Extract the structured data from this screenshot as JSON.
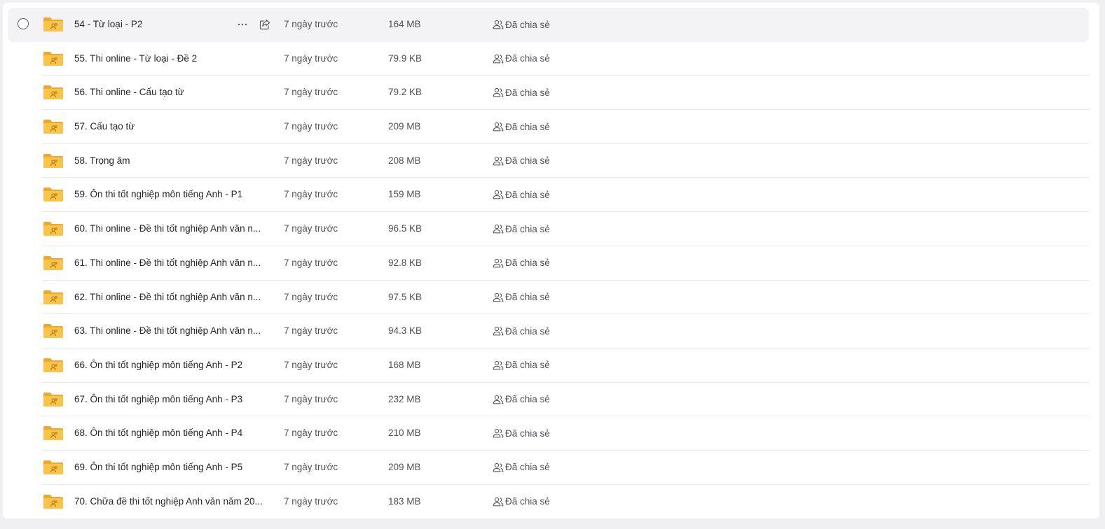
{
  "colors": {
    "folder_body": "#f8c44b",
    "folder_tab": "#eda92d",
    "folder_glyph": "#b57b12",
    "icon_gray": "#5a5a62"
  },
  "icons": {
    "folder": "shared-folder-icon",
    "more": "more-horizontal-icon",
    "share": "share-icon",
    "shared": "users-icon",
    "select": "radio-circle"
  },
  "files": [
    {
      "name": "54 - Từ loại - P2",
      "modified": "7 ngày trước",
      "size": "164 MB",
      "sharing": "Đã chia sẻ"
    },
    {
      "name": "55. Thi online - Từ loại - Đề 2",
      "modified": "7 ngày trước",
      "size": "79.9 KB",
      "sharing": "Đã chia sẻ"
    },
    {
      "name": "56. Thi online - Cấu tạo từ",
      "modified": "7 ngày trước",
      "size": "79.2 KB",
      "sharing": "Đã chia sẻ"
    },
    {
      "name": "57. Cấu tạo từ",
      "modified": "7 ngày trước",
      "size": "209 MB",
      "sharing": "Đã chia sẻ"
    },
    {
      "name": "58. Trọng âm",
      "modified": "7 ngày trước",
      "size": "208 MB",
      "sharing": "Đã chia sẻ"
    },
    {
      "name": "59. Ôn thi tốt nghiệp môn tiếng Anh - P1",
      "modified": "7 ngày trước",
      "size": "159 MB",
      "sharing": "Đã chia sẻ"
    },
    {
      "name": "60. Thi online - Đề thi tốt nghiệp Anh văn n...",
      "modified": "7 ngày trước",
      "size": "96.5 KB",
      "sharing": "Đã chia sẻ"
    },
    {
      "name": "61. Thi online - Đề thi tốt nghiệp Anh văn n...",
      "modified": "7 ngày trước",
      "size": "92.8 KB",
      "sharing": "Đã chia sẻ"
    },
    {
      "name": "62. Thi online - Đề thi tốt nghiệp Anh văn n...",
      "modified": "7 ngày trước",
      "size": "97.5 KB",
      "sharing": "Đã chia sẻ"
    },
    {
      "name": "63. Thi online - Đề thi tốt nghiệp Anh văn n...",
      "modified": "7 ngày trước",
      "size": "94.3 KB",
      "sharing": "Đã chia sẻ"
    },
    {
      "name": "66. Ôn thi tốt nghiệp môn tiếng Anh - P2",
      "modified": "7 ngày trước",
      "size": "168 MB",
      "sharing": "Đã chia sẻ"
    },
    {
      "name": "67. Ôn thi tốt nghiệp môn tiếng Anh - P3",
      "modified": "7 ngày trước",
      "size": "232 MB",
      "sharing": "Đã chia sẻ"
    },
    {
      "name": "68. Ôn thi tốt nghiệp môn tiếng Anh - P4",
      "modified": "7 ngày trước",
      "size": "210 MB",
      "sharing": "Đã chia sẻ"
    },
    {
      "name": "69. Ôn thi tốt nghiệp môn tiếng Anh - P5",
      "modified": "7 ngày trước",
      "size": "209 MB",
      "sharing": "Đã chia sẻ"
    },
    {
      "name": "70. Chữa đề thi tốt nghiệp Anh văn năm 20...",
      "modified": "7 ngày trước",
      "size": "183 MB",
      "sharing": "Đã chia sẻ"
    }
  ]
}
